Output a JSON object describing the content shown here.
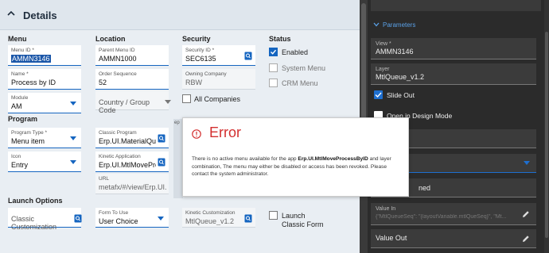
{
  "header": {
    "title": "Details"
  },
  "sections": {
    "menu": "Menu",
    "location": "Location",
    "security": "Security",
    "status": "Status",
    "program": "Program",
    "launch_options": "Launch Options"
  },
  "fields": {
    "menu_id": {
      "label": "Menu ID *",
      "value": "AMMN3146"
    },
    "name": {
      "label": "Name *",
      "value": "Process by ID"
    },
    "module": {
      "label": "Module",
      "value": "AM"
    },
    "parent_menu_id": {
      "label": "Parent Menu ID",
      "value": "AMMN1000"
    },
    "order_sequence": {
      "label": "Order Sequence",
      "value": "52"
    },
    "country_group_code": {
      "placeholder": "Country / Group Code"
    },
    "security_id": {
      "label": "Security ID *",
      "value": "SEC6135"
    },
    "owning_company": {
      "label": "Owning Company",
      "value": "RBW"
    },
    "program_type": {
      "label": "Program Type *",
      "value": "Menu item"
    },
    "icon": {
      "label": "Icon",
      "value": "Entry"
    },
    "classic_program": {
      "label": "Classic Program",
      "value": "Erp.UI.MaterialQue"
    },
    "kinetic_application": {
      "label": "Kinetic Application",
      "value": "Erp.UI.MtlMovePro"
    },
    "url": {
      "label": "URL",
      "value": "metafx/#/view/Erp.UI..."
    },
    "classic_customization": {
      "placeholder": "Classic Customization"
    },
    "form_to_use": {
      "label": "Form To Use",
      "value": "User Choice"
    },
    "kinetic_customization": {
      "label": "Kinetic Customization",
      "value": "MtlQueue_v1.2"
    }
  },
  "checkboxes": {
    "enabled": {
      "label": "Enabled",
      "checked": true
    },
    "system_menu": {
      "label": "System Menu",
      "checked": false
    },
    "crm_menu": {
      "label": "CRM Menu",
      "checked": false
    },
    "all_companies": {
      "label": "All Companies",
      "checked": false
    },
    "launch_classic_form": {
      "label": "Launch Classic Form",
      "checked": false
    }
  },
  "strip_text": "ep",
  "error_dialog": {
    "title": "Error",
    "message_pre": "There is no active menu available for the app ",
    "message_app": "Erp.UI.MtlMoveProcessByID",
    "message_post": " and layer combination, The menu may either be disabled or access has been revoked. Please contact the system administrator."
  },
  "right_panel": {
    "section": "Parameters",
    "view": {
      "label": "View *",
      "value": "AMMN3146"
    },
    "layer": {
      "label": "Layer",
      "value": "MtlQueue_v1.2"
    },
    "slide_out": {
      "label": "Slide Out",
      "checked": true
    },
    "open_in_design_mode": {
      "label": "Open in Design Mode",
      "checked": false
    },
    "partial_field": "ned",
    "value_in": {
      "label": "Value In",
      "value": "{\"MtlQueueSeq\": \"{layoutVariable.mtlQueSeq}\", \"Mt..."
    },
    "value_out": {
      "label": "Value Out"
    }
  },
  "colors": {
    "accent": "#1565c0",
    "error": "#d32f2f",
    "panel_dark": "#2b2b2b",
    "parameters_link": "#5aa0e6"
  }
}
